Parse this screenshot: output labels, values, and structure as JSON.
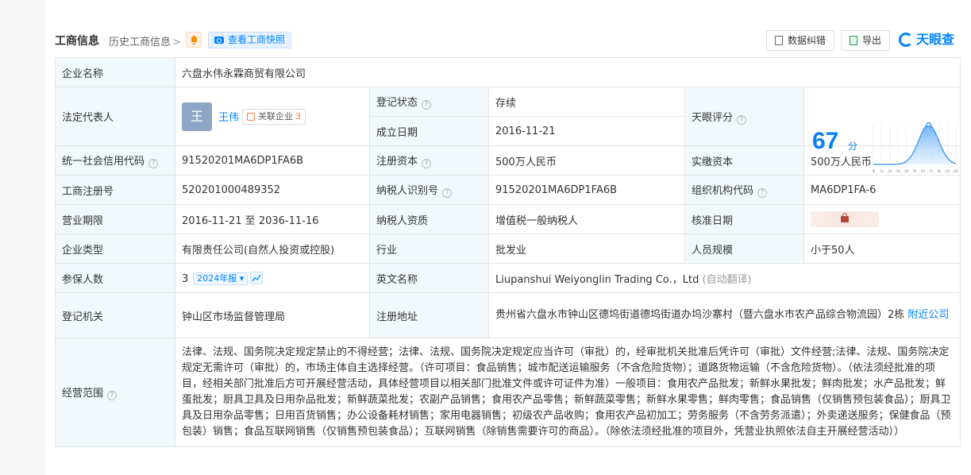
{
  "header": {
    "title": "工商信息",
    "history_label": "历史工商信息",
    "history_chevron": ">",
    "snapshot_label": "查看工商快照",
    "correction_label": "数据纠错",
    "export_label": "导出",
    "brand": "天眼查"
  },
  "rows": {
    "company_name": {
      "label": "企业名称",
      "value": "六盘水伟永霖商贸有限公司"
    },
    "legal_rep": {
      "label": "法定代表人",
      "avatar_char": "王",
      "name": "王伟",
      "related_label": "关联企业",
      "related_count": "3"
    },
    "reg_status": {
      "label": "登记状态",
      "value": "存续"
    },
    "established": {
      "label": "成立日期",
      "value": "2016-11-21"
    },
    "rating": {
      "label": "天眼评分",
      "score": "67",
      "unit": "分",
      "axis_ticks": [
        "0",
        "1",
        "10",
        "20",
        "30",
        "40",
        "50",
        "60",
        "70",
        "80",
        "90",
        "100"
      ]
    },
    "credit_code": {
      "label": "统一社会信用代码",
      "value": "91520201MA6DP1FA6B"
    },
    "reg_capital": {
      "label": "注册资本",
      "value": "500万人民币"
    },
    "paid_capital": {
      "label": "实缴资本",
      "value": "500万人民币"
    },
    "reg_number": {
      "label": "工商注册号",
      "value": "520201000489352"
    },
    "taxpayer_id": {
      "label": "纳税人识别号",
      "value": "91520201MA6DP1FA6B"
    },
    "org_code": {
      "label": "组织机构代码",
      "value": "MA6DP1FA-6"
    },
    "term": {
      "label": "营业期限",
      "value": "2016-11-21 至 2036-11-16"
    },
    "taxpayer_qual": {
      "label": "纳税人资质",
      "value": "增值税一般纳税人"
    },
    "approval_date": {
      "label": "核准日期"
    },
    "company_type": {
      "label": "企业类型",
      "value": "有限责任公司(自然人投资或控股)"
    },
    "industry": {
      "label": "行业",
      "value": "批发业"
    },
    "staff_size": {
      "label": "人员规模",
      "value": "小于50人"
    },
    "insured": {
      "label": "参保人数",
      "value": "3",
      "year_tag": "2024年报"
    },
    "english_name": {
      "label": "英文名称",
      "value": "Liupanshui Weiyonglin Trading Co.，Ltd",
      "note": "(自动翻译)"
    },
    "authority": {
      "label": "登记机关",
      "value": "钟山区市场监督管理局"
    },
    "address": {
      "label": "注册地址",
      "value": "贵州省六盘水市钟山区德坞街道德坞街道办坞沙寨村（暨六盘水市农产品综合物流园）2栋",
      "nearby": "附近公司"
    },
    "scope": {
      "label": "经营范围",
      "value": "法律、法规、国务院决定规定禁止的不得经营；法律、法规、国务院决定规定应当许可（审批）的，经审批机关批准后凭许可（审批）文件经营;法律、法规、国务院决定规定无需许可（审批）的，市场主体自主选择经营。（许可项目：食品销售；城市配送运输服务（不含危险货物）；道路货物运输（不含危险货物）。（依法须经批准的项目，经相关部门批准后方可开展经营活动，具体经营项目以相关部门批准文件或许可证件为准）一般项目：食用农产品批发；新鲜水果批发；鲜肉批发；水产品批发；鲜蛋批发；厨具卫具及日用杂品批发；新鲜蔬菜批发；农副产品销售；食用农产品零售；新鲜蔬菜零售；新鲜水果零售；鲜肉零售；食品销售（仅销售预包装食品）；厨具卫具及日用杂品零售；日用百货销售；办公设备耗材销售；家用电器销售；初级农产品收购；食用农产品初加工；劳务服务（不含劳务派遣）；外卖递送服务；保健食品（预包装）销售；食品互联网销售（仅销售预包装食品）；互联网销售（除销售需要许可的商品）。（除依法须经批准的项目外，凭营业执照依法自主开展经营活动））"
    }
  },
  "colors": {
    "accent": "#0084ff",
    "label_bg": "#f2f9fc",
    "status_green": "#1fb46b",
    "score_blue": "#0a7ef5"
  }
}
